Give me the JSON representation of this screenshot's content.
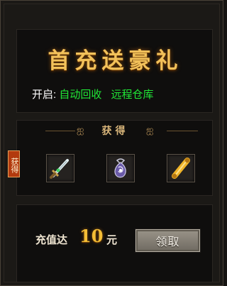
{
  "title": "首充送豪礼",
  "open": {
    "label": "开启:",
    "features": [
      "自动回收",
      "远程仓库"
    ],
    "feature_color": "#20e636"
  },
  "rewards": {
    "header": "获得",
    "badge": "获得",
    "items": [
      {
        "icon": "sword-icon"
      },
      {
        "icon": "amulet-icon"
      },
      {
        "icon": "scroll-icon"
      }
    ]
  },
  "recharge": {
    "prefix": "充值达",
    "amount": "10",
    "unit": "元",
    "button_label": "领取"
  },
  "colors": {
    "title_gold": "#f2c15a",
    "amount_gold": "#f3bd35",
    "badge_red": "#b23a0e"
  }
}
